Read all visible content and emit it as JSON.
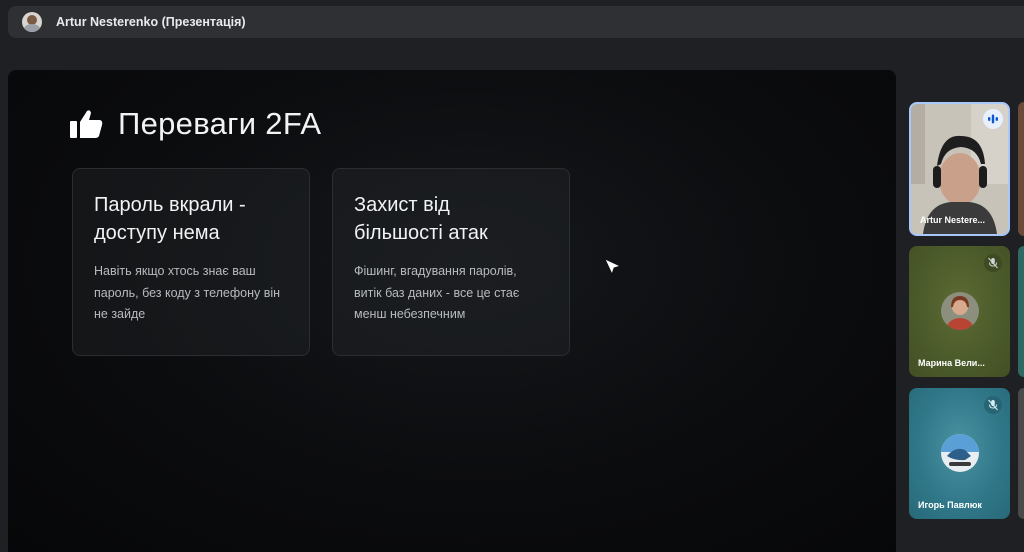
{
  "header": {
    "title": "Artur Nesterenko (Презентація)",
    "avatar_icon": "person-avatar-icon"
  },
  "slide": {
    "title": "Переваги 2FA",
    "title_icon": "thumbs-up-icon",
    "cards": [
      {
        "title_line1": "Пароль вкрали -",
        "title_line2": "доступу нема",
        "line1": "Навіть якщо хтось знає ваш",
        "line2": "пароль, без коду з телефону він",
        "line3": "не зайде"
      },
      {
        "title_line1": "Захист від",
        "title_line2": "більшості атак",
        "line1": "Фішинг, вгадування паролів,",
        "line2": "витік баз даних - все це стає",
        "line3": "менш небезпечним"
      }
    ]
  },
  "participants": [
    {
      "name": "Artur Nestere...",
      "status": "speaking",
      "status_icon": "audio-level-icon"
    },
    {
      "name": "Марина Вели...",
      "status": "muted",
      "status_icon": "mic-off-icon"
    },
    {
      "name": "Игорь Павлюк",
      "status": "muted",
      "status_icon": "mic-off-icon"
    }
  ],
  "colors": {
    "active_speaker_border": "#a8c7fa",
    "tile_2_bg": "#4b5a2a",
    "tile_3_bg": "#2f7788"
  }
}
